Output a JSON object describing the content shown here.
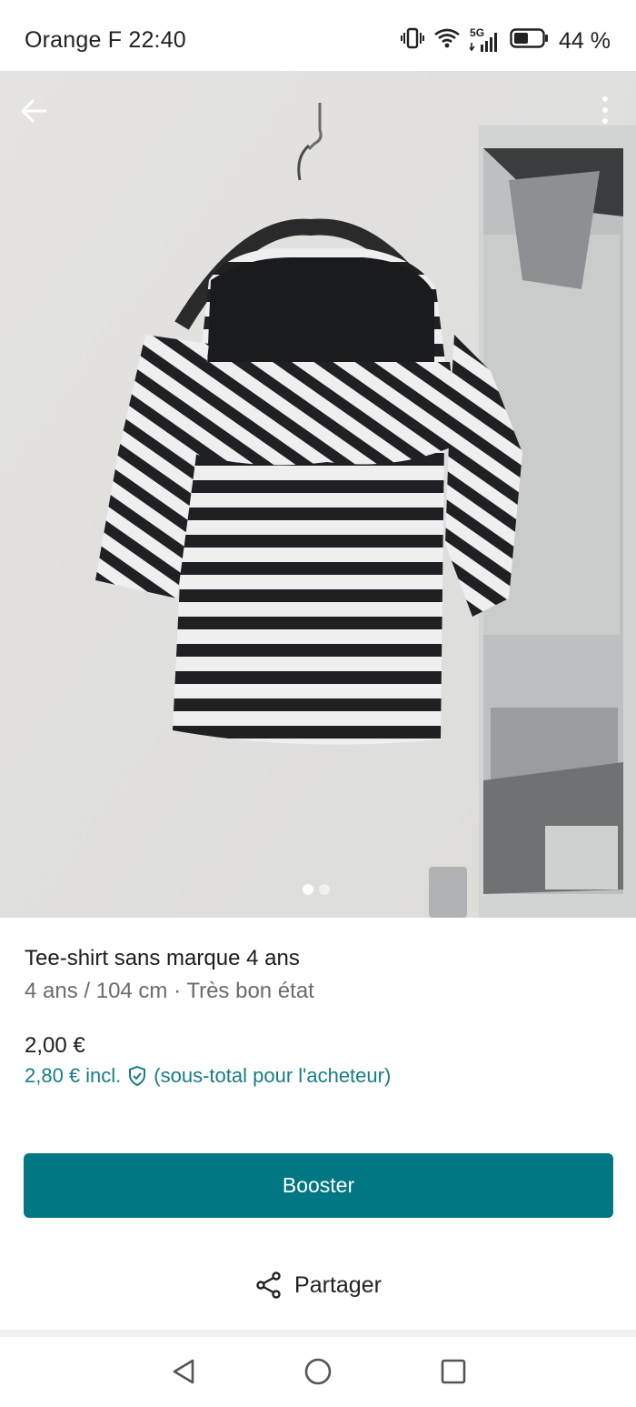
{
  "status_bar": {
    "carrier_time": "Orange F 22:40",
    "network": "5G",
    "battery": "44 %",
    "icons": [
      "vibrate-icon",
      "wifi-icon",
      "signal-icon",
      "battery-icon"
    ]
  },
  "toolbar": {
    "back_icon": "arrow-left-icon",
    "more_icon": "more-vertical-icon"
  },
  "gallery": {
    "image_count": 2,
    "active_index": 0
  },
  "item": {
    "title": "Tee-shirt sans marque 4 ans",
    "subtitle": "4 ans / 104 cm · Très bon état",
    "price": "2,00 €",
    "price_incl": "2,80 €",
    "incl_label": "incl.",
    "protection_note": "(sous-total pour l'acheteur)"
  },
  "actions": {
    "booster_label": "Booster",
    "share_label": "Partager"
  },
  "colors": {
    "accent": "#007782",
    "link_teal": "#157d86"
  }
}
